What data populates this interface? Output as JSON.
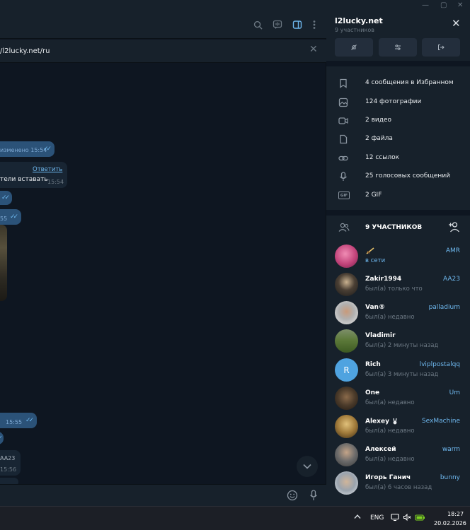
{
  "window": {
    "minimize": "—",
    "maximize": "▢",
    "close": "✕"
  },
  "chat": {
    "pinned_text": "/l2lucky.net/ru",
    "messages": [
      {
        "text": "изменено 15:54"
      },
      {
        "reply_link": "Ответить",
        "text": "тели вставать",
        "time": "15:54"
      },
      {
        "text": ""
      },
      {
        "time": "55"
      },
      {
        "time": "15:55"
      },
      {
        "text": "AA23",
        "time": "15:56"
      }
    ]
  },
  "panel": {
    "title": "l2lucky.net",
    "subtitle": "9 участников",
    "media": [
      {
        "icon": "bookmark-icon",
        "label": "4 сообщения в Избранном"
      },
      {
        "icon": "photo-icon",
        "label": "124 фотографии"
      },
      {
        "icon": "video-icon",
        "label": "2 видео"
      },
      {
        "icon": "file-icon",
        "label": "2 файла"
      },
      {
        "icon": "link-icon",
        "label": "12 ссылок"
      },
      {
        "icon": "microphone-icon",
        "label": "25 голосовых сообщений"
      },
      {
        "icon": "gif-icon",
        "label": "2 GIF",
        "badge": "GIF"
      }
    ],
    "members_title": "9 УЧАСТНИКОВ",
    "members": [
      {
        "name": "",
        "status": "в сети",
        "tag": "AMR",
        "online": true,
        "color": "#c2437a"
      },
      {
        "name": "Zakir1994",
        "status": "был(а) только что",
        "tag": "AA23",
        "color": "#3b3b3b"
      },
      {
        "name": "Van®",
        "status": "был(а) недавно",
        "tag": "palladium",
        "color": "#d7d7d7"
      },
      {
        "name": "Vladimir",
        "status": "был(а) 2 минуты назад",
        "tag": "",
        "color": "#5d7a3a"
      },
      {
        "name": "Rich",
        "status": "был(а) 3 минуты назад",
        "tag": "lviplpostalqq",
        "color": "#4fa3e0",
        "initial": "R"
      },
      {
        "name": "One",
        "status": "был(а) недавно",
        "tag": "Um",
        "color": "#4a3a2a"
      },
      {
        "name": "Alexey",
        "status": "был(а) недавно",
        "tag": "SexMachine",
        "color": "#a07a3a"
      },
      {
        "name": "Алексей",
        "status": "был(а) недавно",
        "tag": "warm",
        "color": "#6a6a6a"
      },
      {
        "name": "Игорь Ганич",
        "status": "был(а) 6 часов назад",
        "tag": "bunny",
        "color": "#9aa3ad"
      }
    ]
  },
  "taskbar": {
    "lang": "ENG",
    "time": "18:27",
    "date": "20.02.2026"
  }
}
